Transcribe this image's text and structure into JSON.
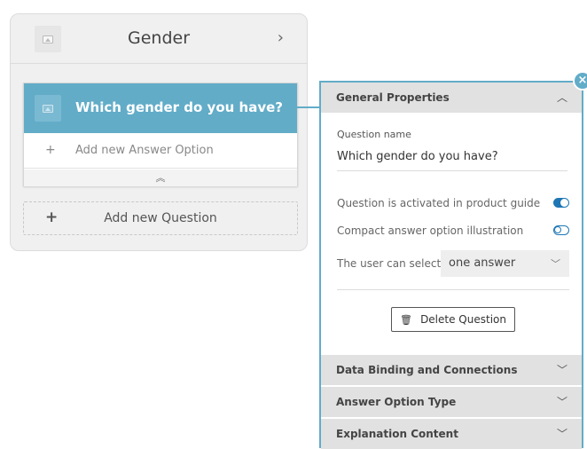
{
  "category": {
    "title": "Gender",
    "chevron": "chevron-right-icon"
  },
  "question": {
    "title": "Which gender do you have?",
    "add_answer_label": "Add new Answer Option",
    "collapse_icon": "double-chevron-up-icon"
  },
  "add_question": {
    "label": "Add new Question"
  },
  "panel": {
    "accent_color": "#62acc8",
    "general": {
      "header": "General Properties",
      "question_name_label": "Question name",
      "question_name_value": "Which gender do you have?",
      "activated_label": "Question is activated in product guide",
      "activated": true,
      "compact_label": "Compact answer option illustration",
      "compact": false,
      "select_label": "The user can select",
      "select_value": "one answer",
      "delete_label": "Delete Question"
    },
    "sections": [
      {
        "label": "Data Binding and Connections"
      },
      {
        "label": "Answer Option Type"
      },
      {
        "label": "Explanation Content"
      }
    ]
  }
}
